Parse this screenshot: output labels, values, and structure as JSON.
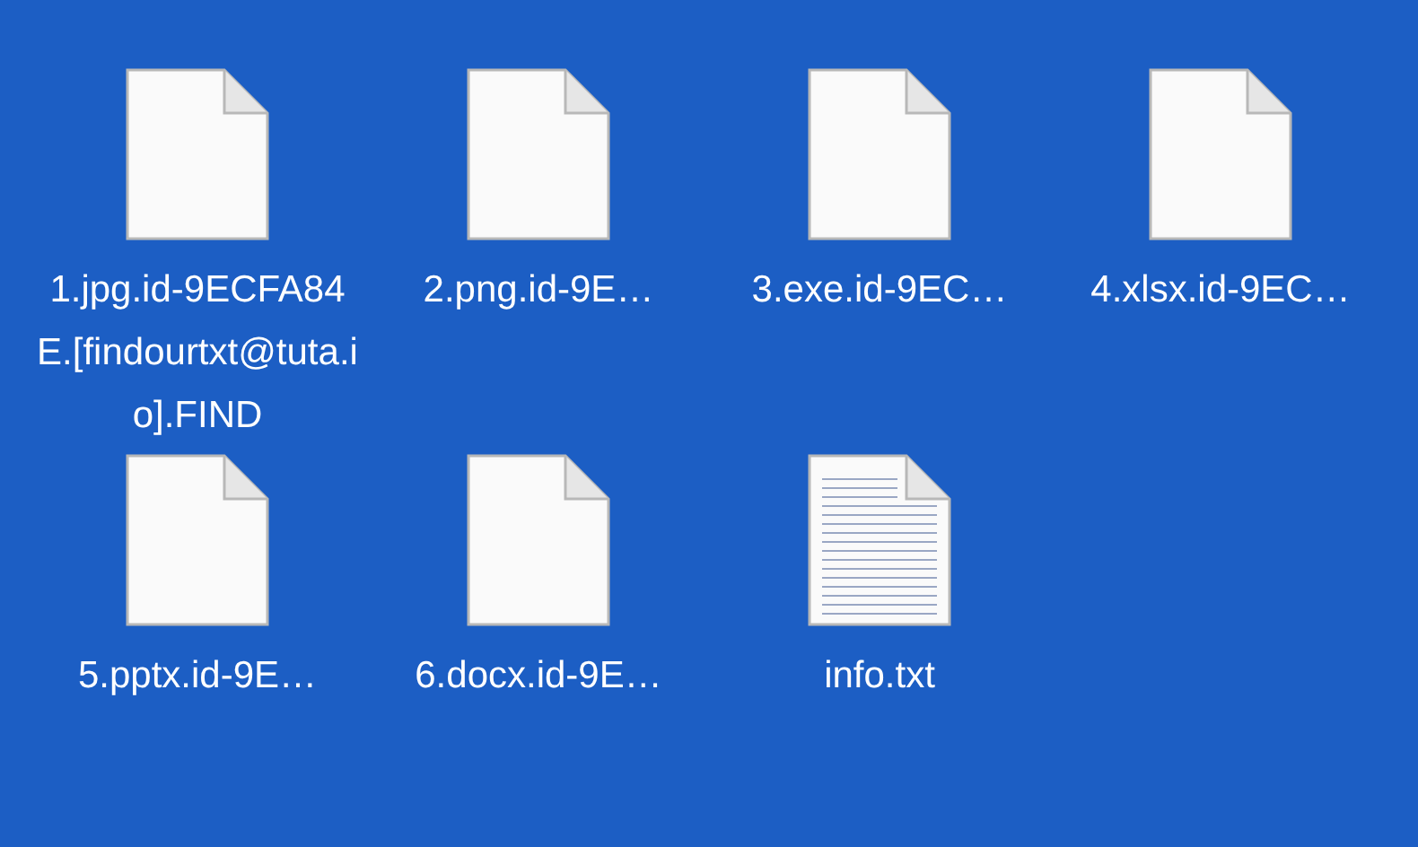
{
  "files": [
    {
      "name": "1.jpg.id-9ECFA84E.[findourtxt@tuta.io].FIND",
      "kind": "blank"
    },
    {
      "name": "2.png.id-9E…",
      "kind": "blank"
    },
    {
      "name": "3.exe.id-9EC…",
      "kind": "blank"
    },
    {
      "name": "4.xlsx.id-9EC…",
      "kind": "blank"
    },
    {
      "name": "5.pptx.id-9E…",
      "kind": "blank"
    },
    {
      "name": "6.docx.id-9E…",
      "kind": "blank"
    },
    {
      "name": "info.txt",
      "kind": "text"
    }
  ]
}
